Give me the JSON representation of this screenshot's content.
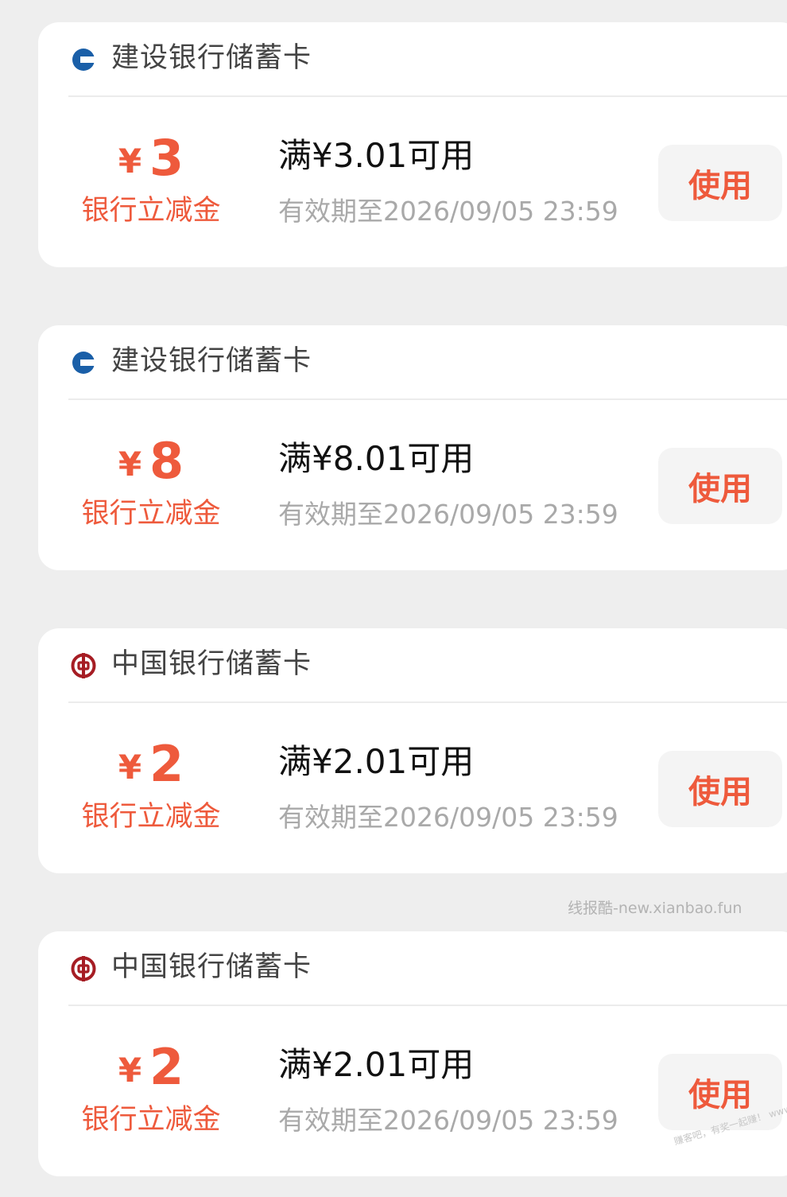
{
  "coupons": [
    {
      "bank": "建设银行储蓄卡",
      "bank_icon": "ccb-logo-icon",
      "bank_color": "#1a5fa8",
      "currency": "¥",
      "amount": "3",
      "amount_label": "银行立减金",
      "condition": "满¥3.01可用",
      "expiry": "有效期至2026/09/05 23:59",
      "button_label": "使用"
    },
    {
      "bank": "建设银行储蓄卡",
      "bank_icon": "ccb-logo-icon",
      "bank_color": "#1a5fa8",
      "currency": "¥",
      "amount": "8",
      "amount_label": "银行立减金",
      "condition": "满¥8.01可用",
      "expiry": "有效期至2026/09/05 23:59",
      "button_label": "使用"
    },
    {
      "bank": "中国银行储蓄卡",
      "bank_icon": "boc-logo-icon",
      "bank_color": "#a61d24",
      "currency": "¥",
      "amount": "2",
      "amount_label": "银行立减金",
      "condition": "满¥2.01可用",
      "expiry": "有效期至2026/09/05 23:59",
      "button_label": "使用"
    },
    {
      "bank": "中国银行储蓄卡",
      "bank_icon": "boc-logo-icon",
      "bank_color": "#a61d24",
      "currency": "¥",
      "amount": "2",
      "amount_label": "银行立减金",
      "condition": "满¥2.01可用",
      "expiry": "有效期至2026/09/05 23:59",
      "button_label": "使用"
    }
  ],
  "watermark": "线报酷-new.xianbao.fun",
  "corner_watermark": "赚客吧，有奖一起赚！ www.zuanke8.com",
  "colors": {
    "accent": "#ee5a3c",
    "background": "#eeeeee",
    "card": "#ffffff",
    "muted_text": "#a9a9a9"
  }
}
